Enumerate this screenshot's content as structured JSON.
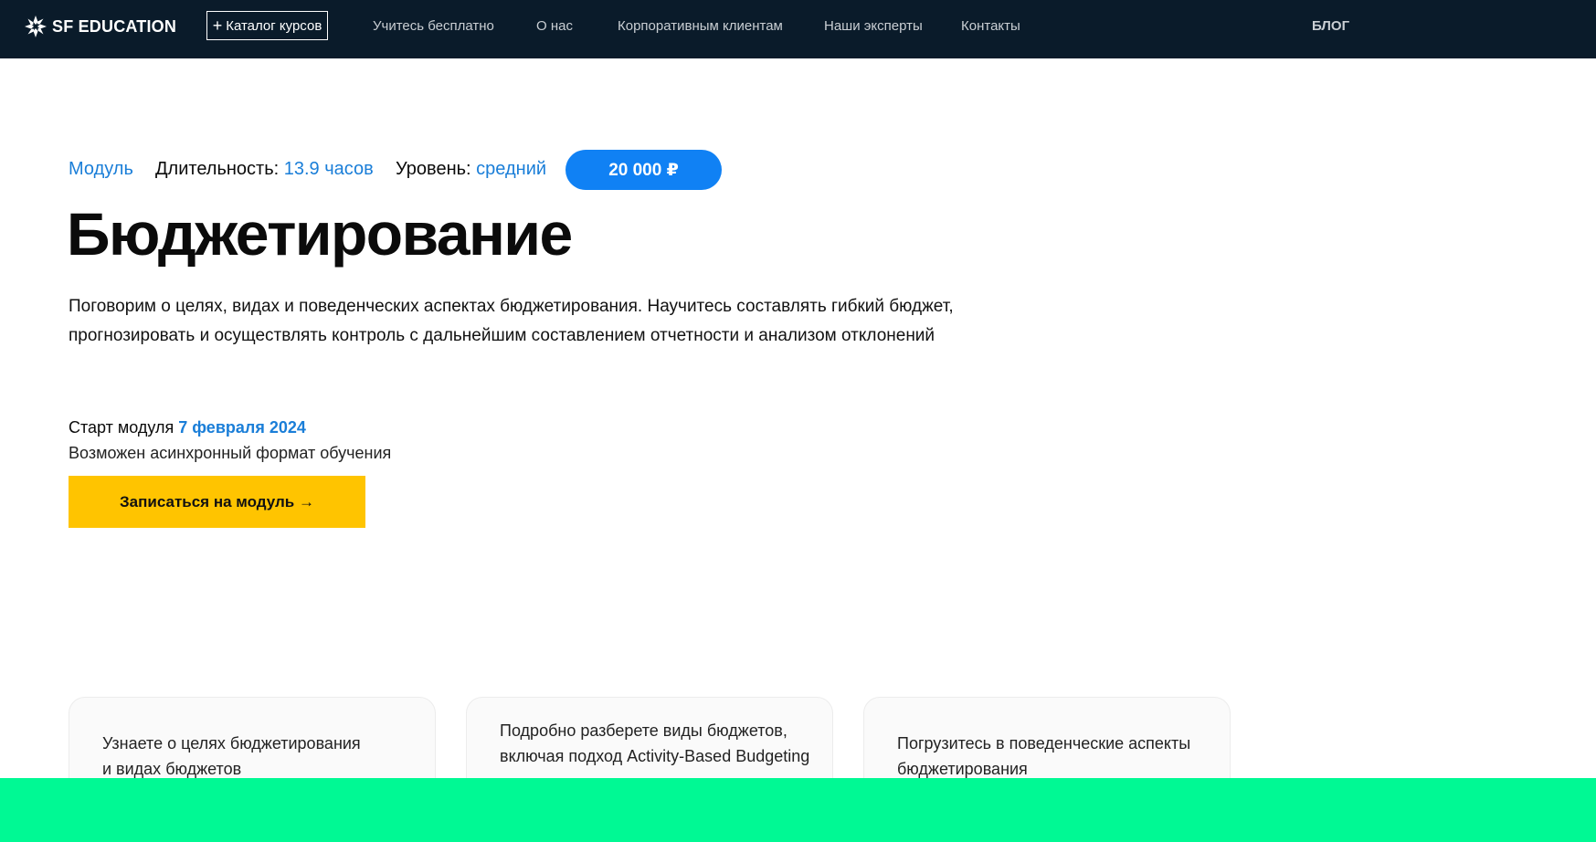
{
  "header": {
    "logo_text": "SF EDUCATION",
    "catalog_label": "Каталог курсов",
    "nav": [
      {
        "label": "Учитесь бесплатно"
      },
      {
        "label": "О нас"
      },
      {
        "label": "Корпоративным клиентам"
      },
      {
        "label": "Наши эксперты"
      },
      {
        "label": "Контакты"
      }
    ],
    "blog_label": "БЛОГ"
  },
  "hero": {
    "type_label": "Модуль",
    "duration_label": "Длительность:",
    "duration_value": "13.9 часов",
    "level_label": "Уровень:",
    "level_value": "средний",
    "price": "20 000 ₽",
    "title": "Бюджетирование",
    "description": "Поговорим о целях, видах и поведенческих аспектах бюджетирования. Научитесь составлять гибкий бюджет, прогнозировать и осуществлять контроль с дальнейшим составлением отчетности и анализом отклонений",
    "start_label": "Старт модуля",
    "start_date": "7 февраля 2024",
    "format_note": "Возможен асинхронный формат обучения",
    "cta_label": "Записаться на модуль →"
  },
  "cards": [
    {
      "text": "Узнаете о целях бюджетирования и видах бюджетов"
    },
    {
      "text": "Подробно разберете виды бюджетов, включая подход Activity-Based Budgeting"
    },
    {
      "text": "Погрузитесь в поведенческие аспекты бюджетирования"
    }
  ],
  "colors": {
    "header_bg": "#0a1b2a",
    "accent_blue": "#1081f4",
    "cta_yellow": "#ffc400",
    "bottom_green": "#00f994"
  }
}
